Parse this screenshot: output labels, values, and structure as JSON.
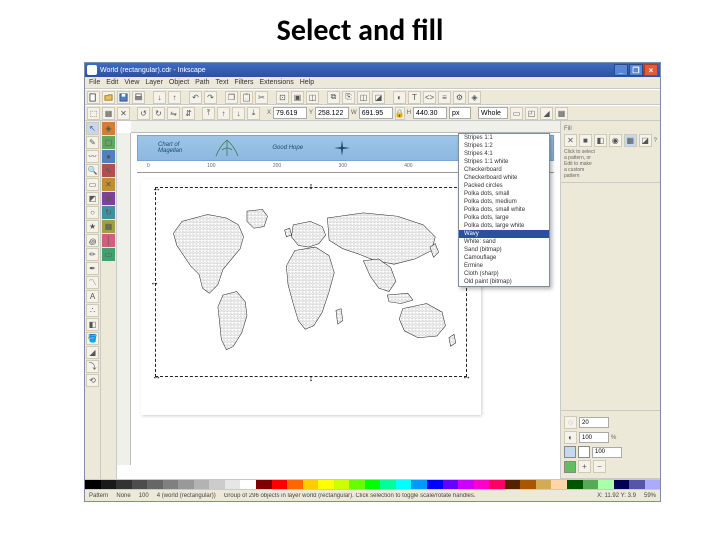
{
  "slide": {
    "title": "Select and fill"
  },
  "window": {
    "title": "World (rectangular).cdr - Inkscape"
  },
  "menubar": [
    "File",
    "Edit",
    "View",
    "Layer",
    "Object",
    "Path",
    "Text",
    "Filters",
    "Extensions",
    "Help"
  ],
  "coord_fields": {
    "x": "79.619",
    "y": "258.122",
    "w": "691.95",
    "h": "440.30",
    "units": "px",
    "zoom": "Whole"
  },
  "banner": {
    "t1": "Chart of",
    "t2": "Magellan",
    "t3": "Good Hope"
  },
  "dropdown": {
    "items": [
      "Stripes 1:1",
      "Stripes 1:2",
      "Stripes 4:1",
      "Stripes 1:1 white",
      "Checkerboard",
      "Checkerboard white",
      "Packed circles",
      "Polka dots, small",
      "Polka dots, medium",
      "Polka dots, small white",
      "Polka dots, large",
      "Polka dots, large white"
    ],
    "selected": "Wavy",
    "rest": [
      "White: sand",
      "Sand (bitmap)",
      "Camouflage",
      "Ermine",
      "Cloth (sharp)",
      "Old paint (bitmap)"
    ]
  },
  "right_panel": {
    "section1_label": "Fill",
    "icons": [
      "?",
      "◯",
      "▤"
    ],
    "spin_a": "20",
    "spin_b": "100",
    "spin_c": "100",
    "info_lines": [
      "Click to select",
      "a pattern, or",
      "Edit to make",
      "a custom",
      "pattern"
    ]
  },
  "statusbar": {
    "fill_label": "Pattern",
    "stroke_label": "None",
    "opacity": "100",
    "sel_info": "4 (world (rectangular))",
    "status_text": "Group of 296 objects in layer world (rectangular). Click selection to toggle scale/rotate handles.",
    "coords": "X: 11.92  Y: 3.9",
    "zoom": "59%"
  },
  "palette": [
    "#000000",
    "#1a1a1a",
    "#333333",
    "#4d4d4d",
    "#666666",
    "#808080",
    "#999999",
    "#b3b3b3",
    "#cccccc",
    "#e6e6e6",
    "#ffffff",
    "#800000",
    "#ff0000",
    "#ff6600",
    "#ffcc00",
    "#ffff00",
    "#ccff00",
    "#66ff00",
    "#00ff00",
    "#00ff99",
    "#00ffff",
    "#0099ff",
    "#0000ff",
    "#6600ff",
    "#cc00ff",
    "#ff00cc",
    "#ff0066",
    "#552200",
    "#aa5500",
    "#d4aa55",
    "#ffd5aa",
    "#005500",
    "#55aa55",
    "#aaffaa",
    "#000055",
    "#5555aa",
    "#aaaaff"
  ]
}
